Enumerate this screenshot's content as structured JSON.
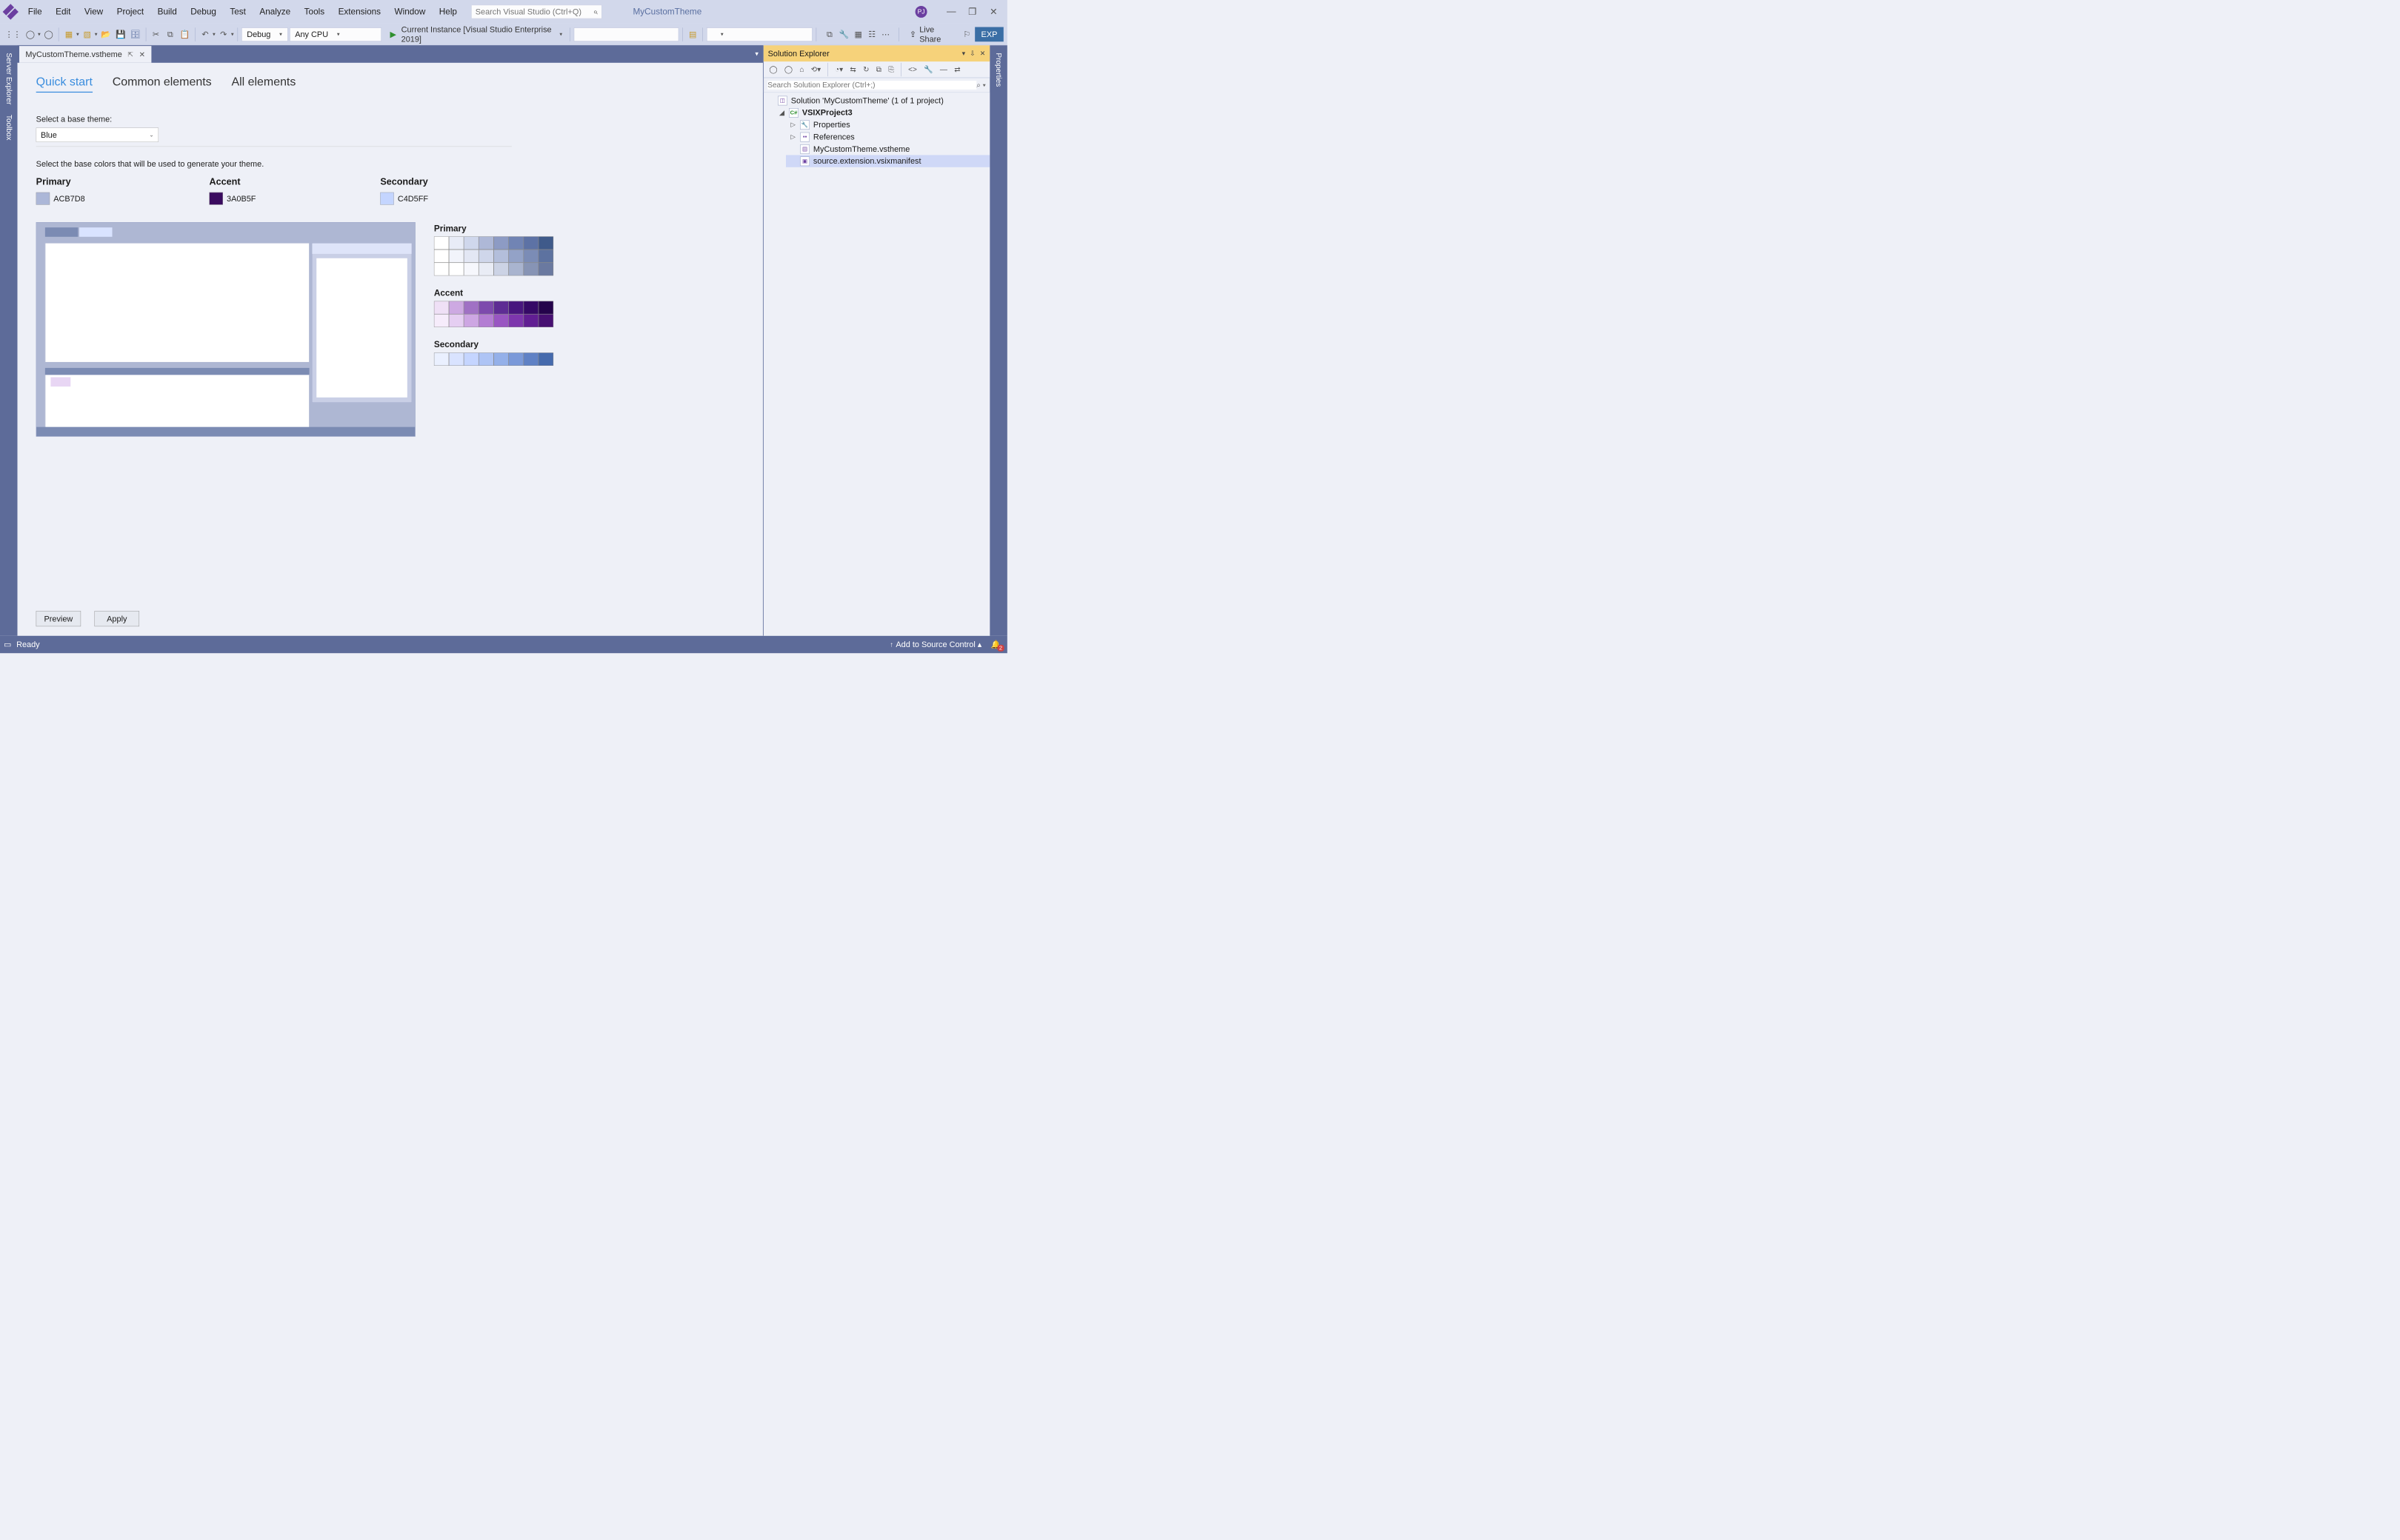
{
  "menu": {
    "items": [
      "File",
      "Edit",
      "View",
      "Project",
      "Build",
      "Debug",
      "Test",
      "Analyze",
      "Tools",
      "Extensions",
      "Window",
      "Help"
    ]
  },
  "search": {
    "placeholder": "Search Visual Studio (Ctrl+Q)"
  },
  "solution_name": "MyCustomTheme",
  "avatar": "PJ",
  "toolbar": {
    "config": "Debug",
    "platform": "Any CPU",
    "start": "Current Instance [Visual Studio Enterprise 2019]",
    "live_share": "Live Share",
    "exp": "EXP"
  },
  "left_rails": [
    "Server Explorer",
    "Toolbox"
  ],
  "right_rails": [
    "Properties"
  ],
  "file_tab": {
    "name": "MyCustomTheme.vstheme"
  },
  "sections": {
    "tabs": [
      "Quick start",
      "Common elements",
      "All elements"
    ],
    "active": 0
  },
  "theme_selector": {
    "label": "Select a base theme:",
    "value": "Blue"
  },
  "base_colors_label": "Select the base colors that will be used to generate your theme.",
  "colors": {
    "primary": {
      "title": "Primary",
      "hex": "ACB7D8",
      "swatch": "#ACB7D8"
    },
    "accent": {
      "title": "Accent",
      "hex": "3A0B5F",
      "swatch": "#3A0B5F"
    },
    "secondary": {
      "title": "Secondary",
      "hex": "C4D5FF",
      "swatch": "#C4D5FF"
    }
  },
  "palettes": {
    "primary": {
      "title": "Primary",
      "rows": [
        [
          "#ffffff",
          "#e8ecf7",
          "#cfd7ec",
          "#aeb8d7",
          "#8d9bc4",
          "#7184b4",
          "#5d72a5",
          "#3f5a8a"
        ],
        [
          "#ffffff",
          "#f2f4fb",
          "#e3e7f4",
          "#cfd6ea",
          "#b3bedb",
          "#93a2c7",
          "#7b8cb6",
          "#5d72a0"
        ],
        [
          "#ffffff",
          "#ffffff",
          "#f6f7fc",
          "#e9ecf5",
          "#ccd3e5",
          "#a9b4cf",
          "#8794b5",
          "#6a79a0"
        ]
      ]
    },
    "accent": {
      "title": "Accent",
      "rows": [
        [
          "#efe0f6",
          "#cda9e2",
          "#a071c4",
          "#7d4aad",
          "#5e2c94",
          "#48167e",
          "#350966",
          "#24034b"
        ],
        [
          "#f6ecfb",
          "#e5cef2",
          "#cda6e3",
          "#b37dd3",
          "#9956c2",
          "#7d36ad",
          "#611e93",
          "#471072"
        ]
      ]
    },
    "secondary": {
      "title": "Secondary",
      "rows": [
        [
          "#eaf0ff",
          "#d9e3ff",
          "#c5d5ff",
          "#aec4f5",
          "#94b0e9",
          "#7a99d9",
          "#5f81c5",
          "#456aad"
        ]
      ]
    }
  },
  "buttons": {
    "preview": "Preview",
    "apply": "Apply"
  },
  "solution_explorer": {
    "title": "Solution Explorer",
    "search_placeholder": "Search Solution Explorer (Ctrl+;)",
    "root": "Solution 'MyCustomTheme' (1 of 1 project)",
    "project": "VSIXProject3",
    "properties": "Properties",
    "references": "References",
    "theme_file": "MyCustomTheme.vstheme",
    "manifest": "source.extension.vsixmanifest"
  },
  "status": {
    "ready": "Ready",
    "source_control": "Add to Source Control",
    "notifications": "2"
  },
  "mock": {
    "tab1": "#7b8bb3",
    "tab2": "#d9e3ff"
  }
}
